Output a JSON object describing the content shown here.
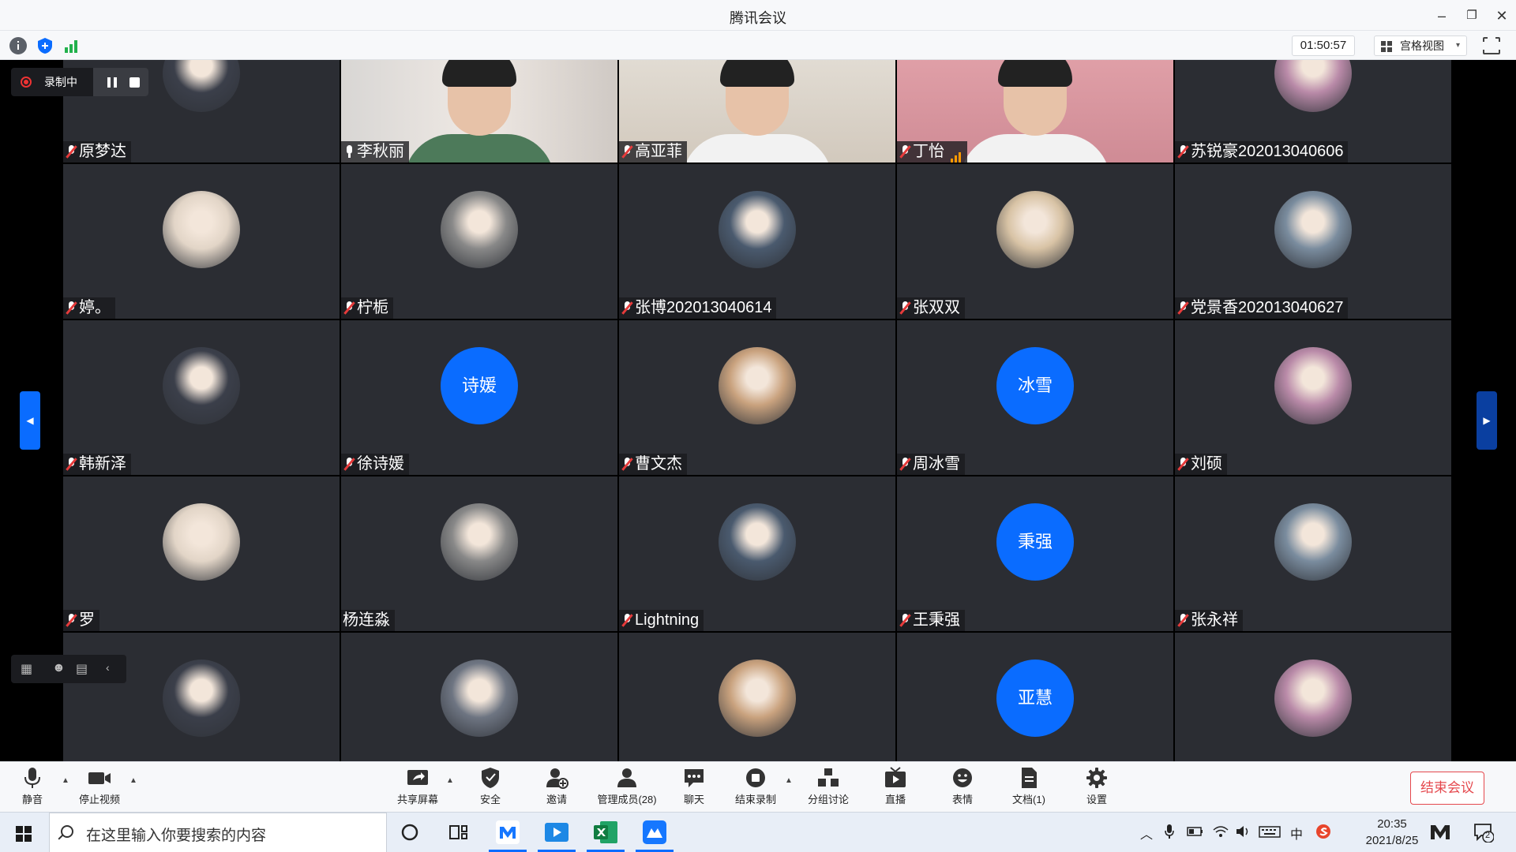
{
  "window": {
    "title": "腾讯会议",
    "min": "–",
    "max": "❐",
    "close": "✕"
  },
  "infobar": {
    "timer": "01:50:57",
    "view_label": "宫格视图",
    "view_caret": "▾"
  },
  "recording": {
    "label": "录制中"
  },
  "participants": [
    {
      "name": "原梦达",
      "mic": "off"
    },
    {
      "name": "李秋丽",
      "mic": "on"
    },
    {
      "name": "高亚菲",
      "mic": "off"
    },
    {
      "name": "丁怡",
      "mic": "off"
    },
    {
      "name": "苏锐豪202013040606",
      "mic": "off"
    },
    {
      "name": "婷。",
      "mic": "off"
    },
    {
      "name": "柠栀",
      "mic": "off"
    },
    {
      "name": "张博202013040614",
      "mic": "off"
    },
    {
      "name": "张双双",
      "mic": "off"
    },
    {
      "name": "党景香202013040627",
      "mic": "off"
    },
    {
      "name": "韩新泽",
      "mic": "off"
    },
    {
      "name": "徐诗媛",
      "mic": "off",
      "avatar_text": "诗媛"
    },
    {
      "name": "曹文杰",
      "mic": "off"
    },
    {
      "name": "周冰雪",
      "mic": "off",
      "avatar_text": "冰雪"
    },
    {
      "name": "刘硕",
      "mic": "off"
    },
    {
      "name": "罗",
      "mic": "off"
    },
    {
      "name": "杨连淼",
      "mic": "none"
    },
    {
      "name": "Lightning",
      "mic": "off"
    },
    {
      "name": "王秉强",
      "mic": "off",
      "avatar_text": "秉强"
    },
    {
      "name": "张永祥",
      "mic": "off"
    },
    {
      "name": "",
      "mic": "none"
    },
    {
      "name": "",
      "mic": "none"
    },
    {
      "name": "",
      "mic": "none"
    },
    {
      "name": "",
      "mic": "none",
      "avatar_text": "亚慧"
    },
    {
      "name": "",
      "mic": "none"
    }
  ],
  "toolbar": {
    "mute": "静音",
    "stop_video": "停止视频",
    "share_screen": "共享屏幕",
    "security": "安全",
    "invite": "邀请",
    "manage_members": "管理成员(28)",
    "chat": "聊天",
    "end_recording": "结束录制",
    "breakout": "分组讨论",
    "live": "直播",
    "reactions": "表情",
    "docs": "文档(1)",
    "settings": "设置",
    "end_meeting": "结束会议"
  },
  "taskbar": {
    "search_placeholder": "在这里输入你要搜索的内容",
    "ime": "中",
    "time": "20:35",
    "date": "2021/8/25",
    "notif_count": "2"
  }
}
